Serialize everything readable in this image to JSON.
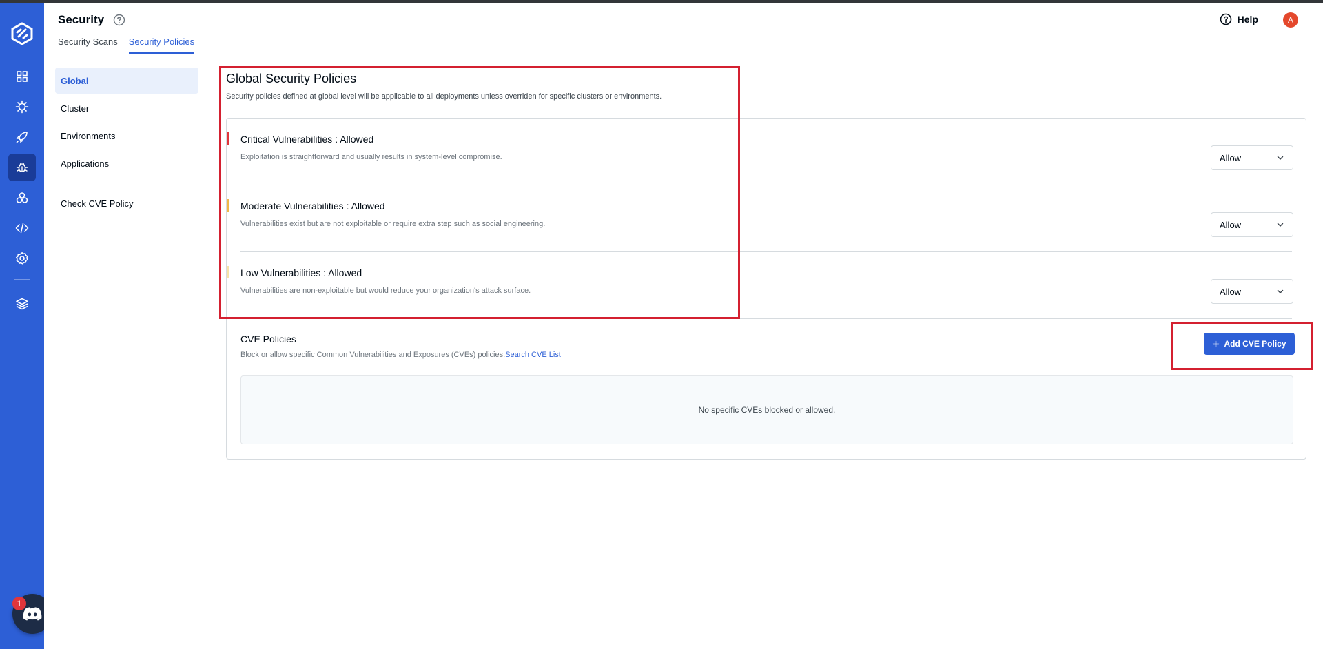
{
  "header": {
    "title": "Security",
    "tabs": [
      {
        "label": "Security Scans",
        "active": false
      },
      {
        "label": "Security Policies",
        "active": true
      }
    ],
    "help_label": "Help",
    "avatar_initial": "A"
  },
  "subnav": {
    "items": [
      {
        "label": "Global",
        "active": true
      },
      {
        "label": "Cluster",
        "active": false
      },
      {
        "label": "Environments",
        "active": false
      },
      {
        "label": "Applications",
        "active": false
      }
    ],
    "extra_item": "Check CVE Policy"
  },
  "main": {
    "title": "Global Security Policies",
    "description": "Security policies defined at global level will be applicable to all deployments unless overriden for specific clusters or environments.",
    "policies": [
      {
        "title": "Critical Vulnerabilities : Allowed",
        "description": "Exploitation is straightforward and usually results in system-level compromise.",
        "value": "Allow",
        "color": "#e0353b"
      },
      {
        "title": "Moderate Vulnerabilities : Allowed",
        "description": "Vulnerabilities exist but are not exploitable or require extra step such as social engineering.",
        "value": "Allow",
        "color": "#f0b94a"
      },
      {
        "title": "Low Vulnerabilities : Allowed",
        "description": "Vulnerabilities are non-exploitable but would reduce your organization's attack surface.",
        "value": "Allow",
        "color": "#f6e4a8"
      }
    ],
    "cve": {
      "title": "CVE Policies",
      "description": "Block or allow specific Common Vulnerabilities and Exposures (CVEs) policies.",
      "link": "Search CVE List",
      "add_button": "Add CVE Policy",
      "empty_text": "No specific CVEs blocked or allowed."
    }
  },
  "discord": {
    "badge_count": "1"
  },
  "colors": {
    "accent": "#2d5fd6",
    "nav_bg": "#2d5fd6",
    "highlight": "#d42030"
  }
}
